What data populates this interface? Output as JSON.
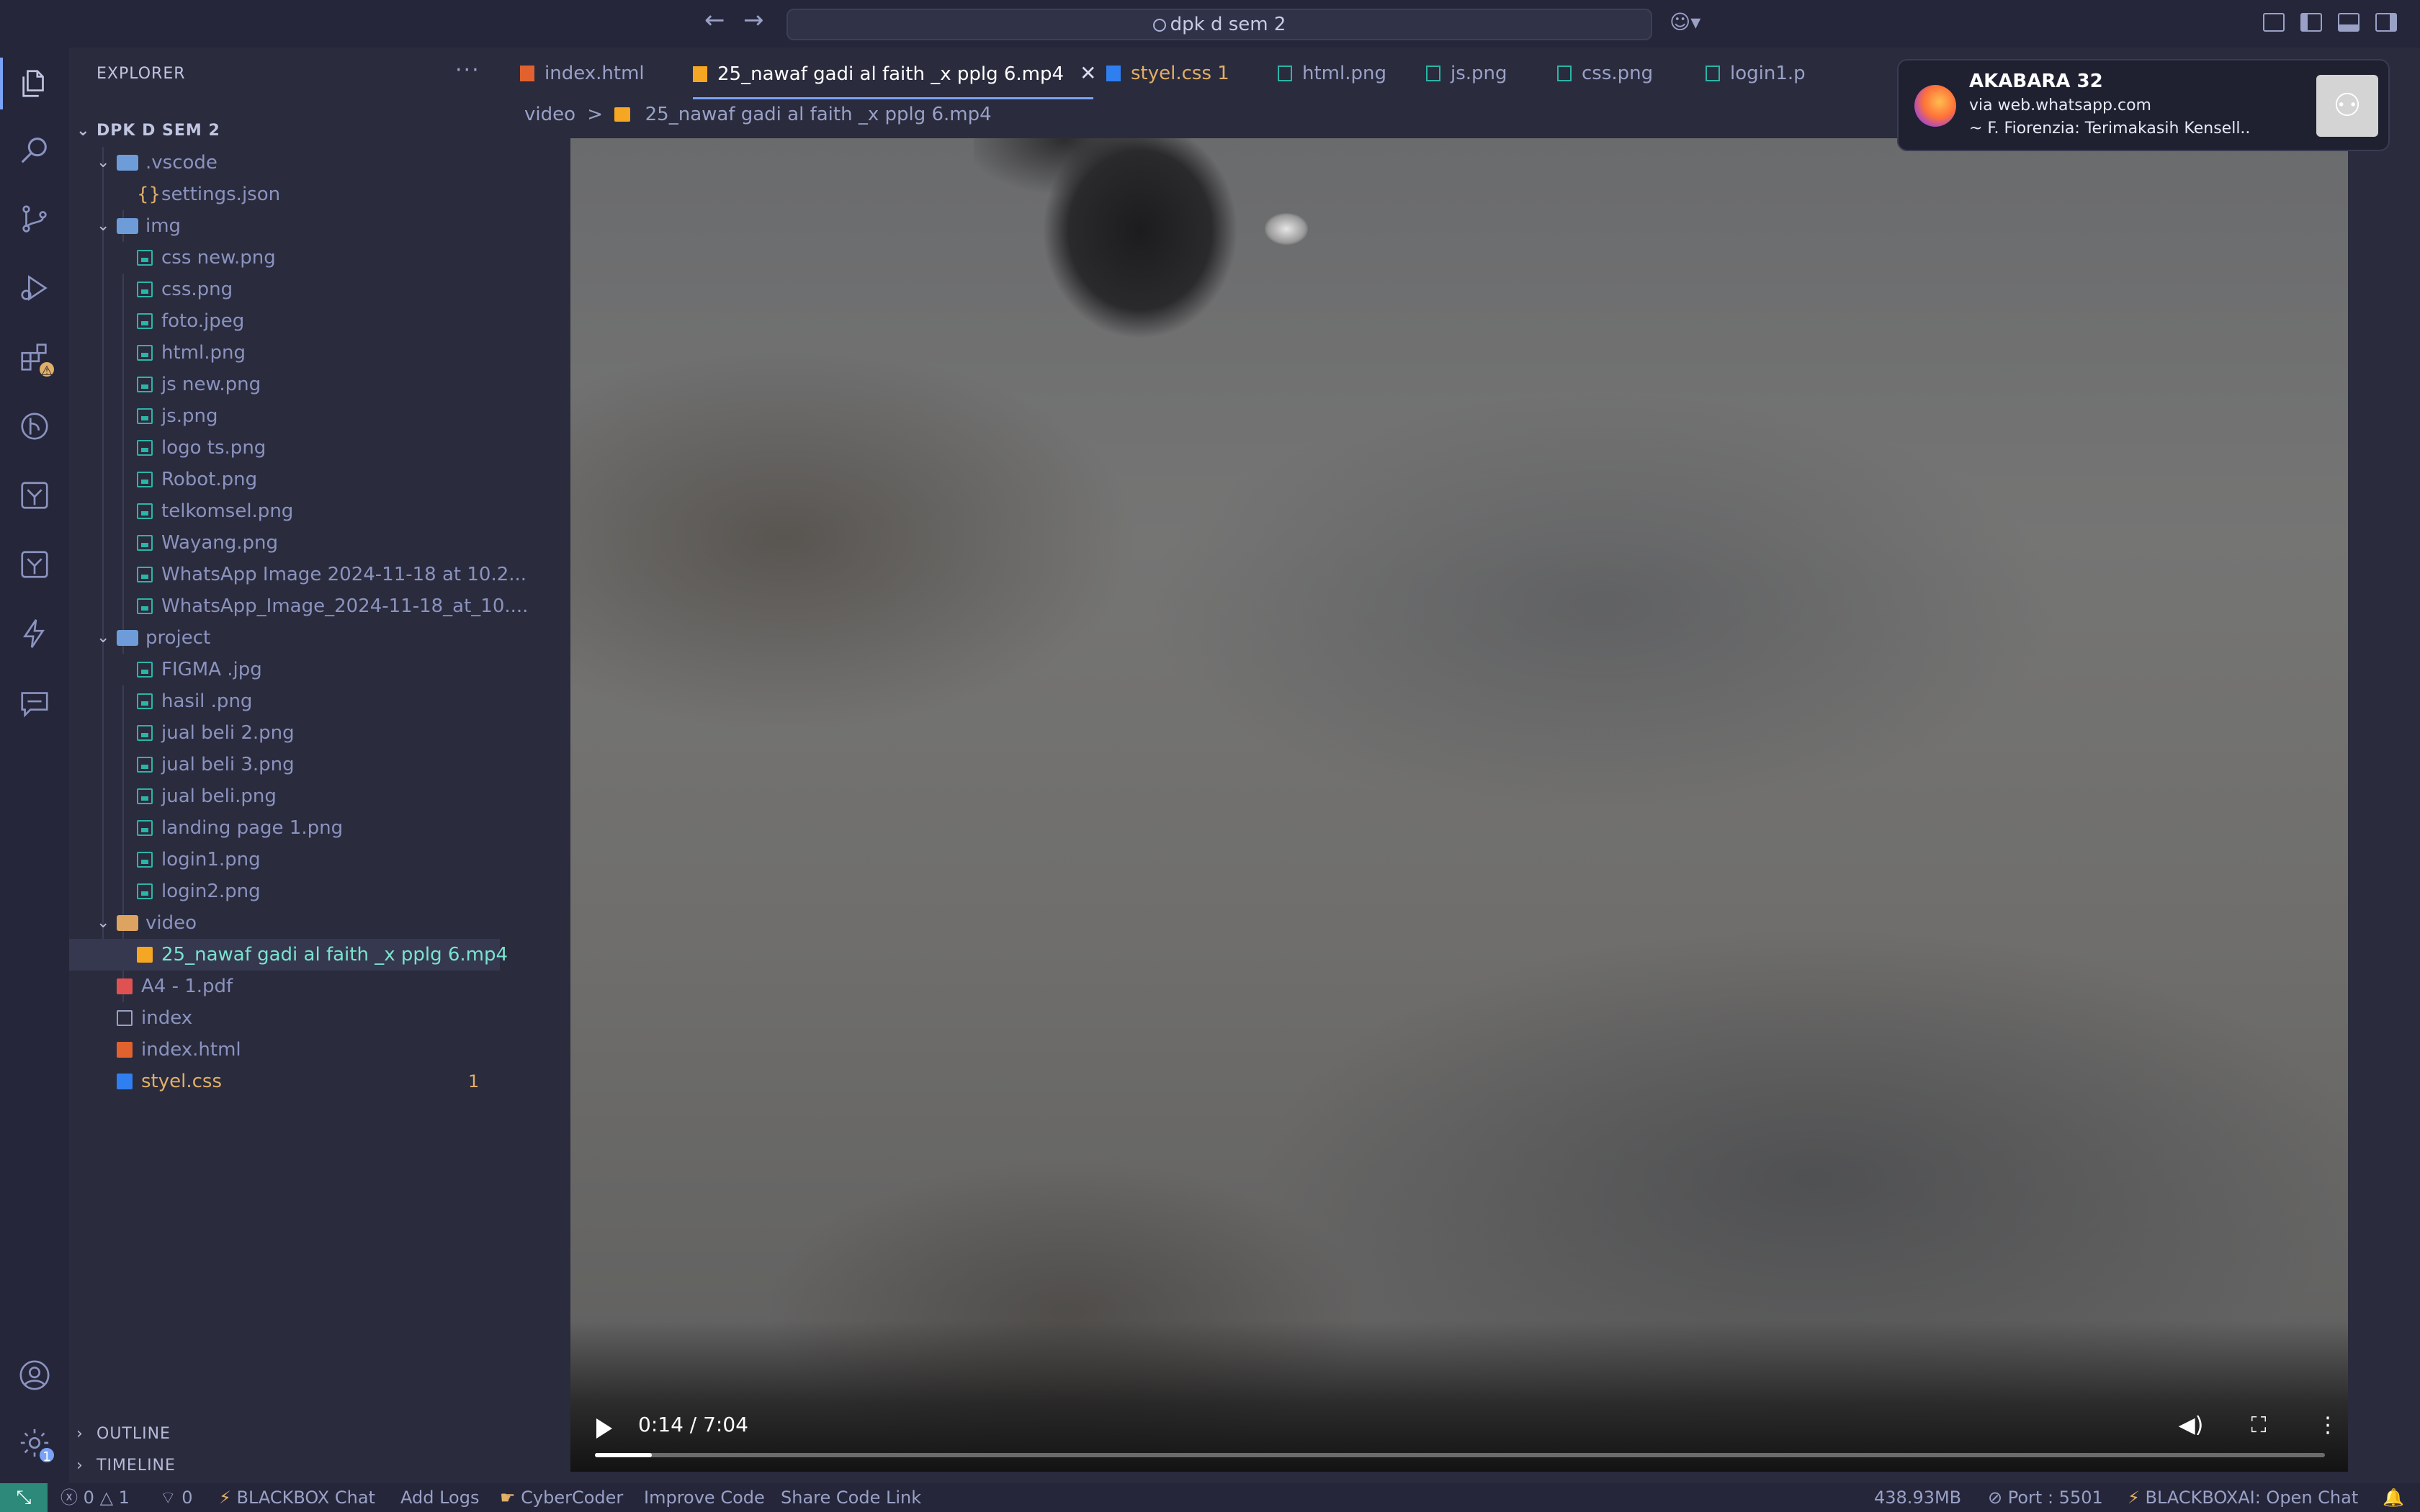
{
  "titlebar": {
    "search_text": "dpk d sem 2",
    "back_icon": "arrow-left",
    "forward_icon": "arrow-right",
    "copilot_icon": "copilot"
  },
  "activity_bar": {
    "items": [
      "explorer-icon",
      "search-icon",
      "source-control-icon",
      "run-debug-icon",
      "extensions-icon",
      "git-graph-icon",
      "deploy-icon",
      "deploy-alt-icon",
      "bolt-icon",
      "chat-icon"
    ],
    "extensions_badge": "⚠",
    "settings_badge": "1"
  },
  "sidebar": {
    "title": "EXPLORER",
    "more": "···",
    "root": "DPK D SEM 2",
    "tree": [
      {
        "label": ".vscode",
        "kind": "folder"
      },
      {
        "label": "settings.json",
        "kind": "json"
      },
      {
        "label": "img",
        "kind": "folder"
      },
      {
        "label": "css new.png",
        "kind": "png"
      },
      {
        "label": "css.png",
        "kind": "png"
      },
      {
        "label": "foto.jpeg",
        "kind": "png"
      },
      {
        "label": "html.png",
        "kind": "png"
      },
      {
        "label": "js new.png",
        "kind": "png"
      },
      {
        "label": "js.png",
        "kind": "png"
      },
      {
        "label": "logo ts.png",
        "kind": "png"
      },
      {
        "label": "Robot.png",
        "kind": "png"
      },
      {
        "label": "telkomsel.png",
        "kind": "png"
      },
      {
        "label": "Wayang.png",
        "kind": "png"
      },
      {
        "label": "WhatsApp Image 2024-11-18 at 10.2...",
        "kind": "png"
      },
      {
        "label": "WhatsApp_Image_2024-11-18_at_10....",
        "kind": "png"
      },
      {
        "label": "project",
        "kind": "folder"
      },
      {
        "label": "FIGMA .jpg",
        "kind": "png"
      },
      {
        "label": "hasil .png",
        "kind": "png"
      },
      {
        "label": "jual beli 2.png",
        "kind": "png"
      },
      {
        "label": "jual beli 3.png",
        "kind": "png"
      },
      {
        "label": "jual beli.png",
        "kind": "png"
      },
      {
        "label": "landing page 1.png",
        "kind": "png"
      },
      {
        "label": "login1.png",
        "kind": "png"
      },
      {
        "label": "login2.png",
        "kind": "png"
      },
      {
        "label": "video",
        "kind": "folder-open"
      },
      {
        "label": "25_nawaf gadi al faith _x pplg 6.mp4",
        "kind": "video"
      },
      {
        "label": "A4 - 1.pdf",
        "kind": "pdf"
      },
      {
        "label": "index",
        "kind": "file"
      },
      {
        "label": "index.html",
        "kind": "html"
      },
      {
        "label": "styel.css",
        "kind": "css",
        "count": "1"
      }
    ],
    "outline": "OUTLINE",
    "timeline": "TIMELINE"
  },
  "tabs": [
    {
      "label": "index.html",
      "kind": "html"
    },
    {
      "label": "25_nawaf gadi al faith _x pplg 6.mp4",
      "kind": "video",
      "active": true
    },
    {
      "label": "styel.css 1",
      "kind": "css",
      "warn": true
    },
    {
      "label": "html.png",
      "kind": "png"
    },
    {
      "label": "js.png",
      "kind": "png"
    },
    {
      "label": "css.png",
      "kind": "png"
    },
    {
      "label": "login1.p",
      "kind": "png"
    }
  ],
  "breadcrumb": {
    "folder": "video",
    "sep": ">",
    "file": "25_nawaf gadi al faith _x pplg 6.mp4"
  },
  "video": {
    "time": "0:14 / 7:04",
    "progress": 0.033
  },
  "notification": {
    "title": "AKABARA 32",
    "subtitle": "via web.whatsapp.com",
    "message": "~ F. Fiorenzia: Terimakasih Kensell.."
  },
  "statusbar": {
    "errors": "0",
    "warnings": "1",
    "ports": "0",
    "blackbox_chat": "BLACKBOX Chat",
    "add_logs": "Add Logs",
    "cybercoder": "CyberCoder",
    "improve_code": "Improve Code",
    "share_link": "Share Code Link",
    "memory": "438.93MB",
    "port": "Port : 5501",
    "blackboxai": "BLACKBOXAI: Open Chat"
  }
}
